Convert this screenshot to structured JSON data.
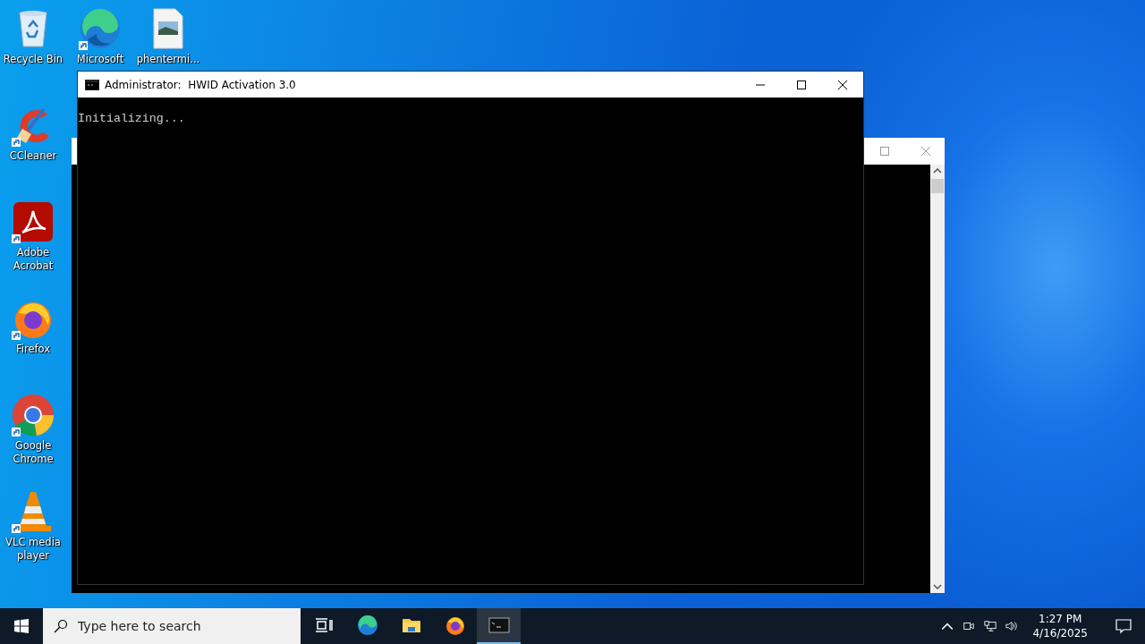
{
  "desktop_icons": [
    {
      "kind": "bin",
      "label": "Recycle Bin",
      "shortcut": false
    },
    {
      "kind": "edge",
      "label": "Microsoft",
      "shortcut": true
    },
    {
      "kind": "image",
      "label": "phentermi...",
      "shortcut": false
    },
    {
      "kind": "ccleaner",
      "label": "CCleaner",
      "shortcut": true
    },
    {
      "kind": "acrobat",
      "label": "Adobe Acrobat",
      "shortcut": true
    },
    {
      "kind": "firefox",
      "label": "Firefox",
      "shortcut": true
    },
    {
      "kind": "chrome",
      "label": "Google Chrome",
      "shortcut": true
    },
    {
      "kind": "vlc",
      "label": "VLC media player",
      "shortcut": true
    }
  ],
  "console_window": {
    "title": "Administrator:  HWID Activation 3.0",
    "lines": [
      "Initializing..."
    ]
  },
  "taskbar": {
    "search": {
      "placeholder": "Type here to search"
    },
    "apps": [
      {
        "kind": "taskview",
        "selected": false
      },
      {
        "kind": "edge",
        "selected": false
      },
      {
        "kind": "explorer",
        "selected": false
      },
      {
        "kind": "firefox",
        "selected": false
      },
      {
        "kind": "console",
        "selected": true
      }
    ],
    "clock": {
      "time": "1:27 PM",
      "date": "4/16/2025"
    }
  }
}
